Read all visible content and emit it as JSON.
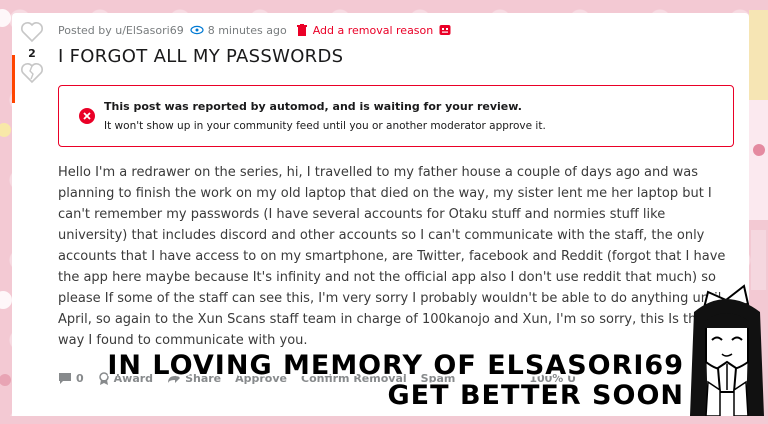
{
  "post": {
    "author": "Posted by u/ElSasori69",
    "time": "8 minutes ago",
    "removal_link": "Add a removal reason",
    "vote_count": "2",
    "title": "I FORGOT ALL MY PASSWORDS",
    "alert": {
      "title": "This post was reported by automod, and is waiting for your review.",
      "subtitle": "It won't show up in your community feed until you or another moderator approve it."
    },
    "body": "Hello I'm a redrawer on the series, hi, I travelled to my father house a couple of days ago and was planning to finish the work on my old laptop that died on the way, my sister lent me her laptop but I can't remember my passwords (I have several accounts for Otaku stuff and normies stuff like university) that includes discord and other accounts so I can't communicate with the staff, the only accounts that I have access to on my smartphone, are Twitter, facebook and Reddit (forgot that I have the app here maybe because It's infinity and not the official app also I don't use reddit that much) so please If some of the staff can see this, I'm very sorry I probably wouldn't be able to do anything until April, so again to the Xun Scans staff team in charge of 100kanojo and Xun, I'm so sorry, this Is the only way I found to communicate with you."
  },
  "actions": {
    "comments": "0",
    "award": "Award",
    "share": "Share",
    "approve": "Approve",
    "remove": "Confirm Removal",
    "spam": "Spam",
    "upvoted": "100% U"
  },
  "overlay": {
    "line1": "In loving memory of ElSasori69",
    "line2": "Get better soon"
  },
  "colors": {
    "accent": "#ea0027",
    "orange": "#ff4500",
    "background": "#f3c9d3"
  }
}
